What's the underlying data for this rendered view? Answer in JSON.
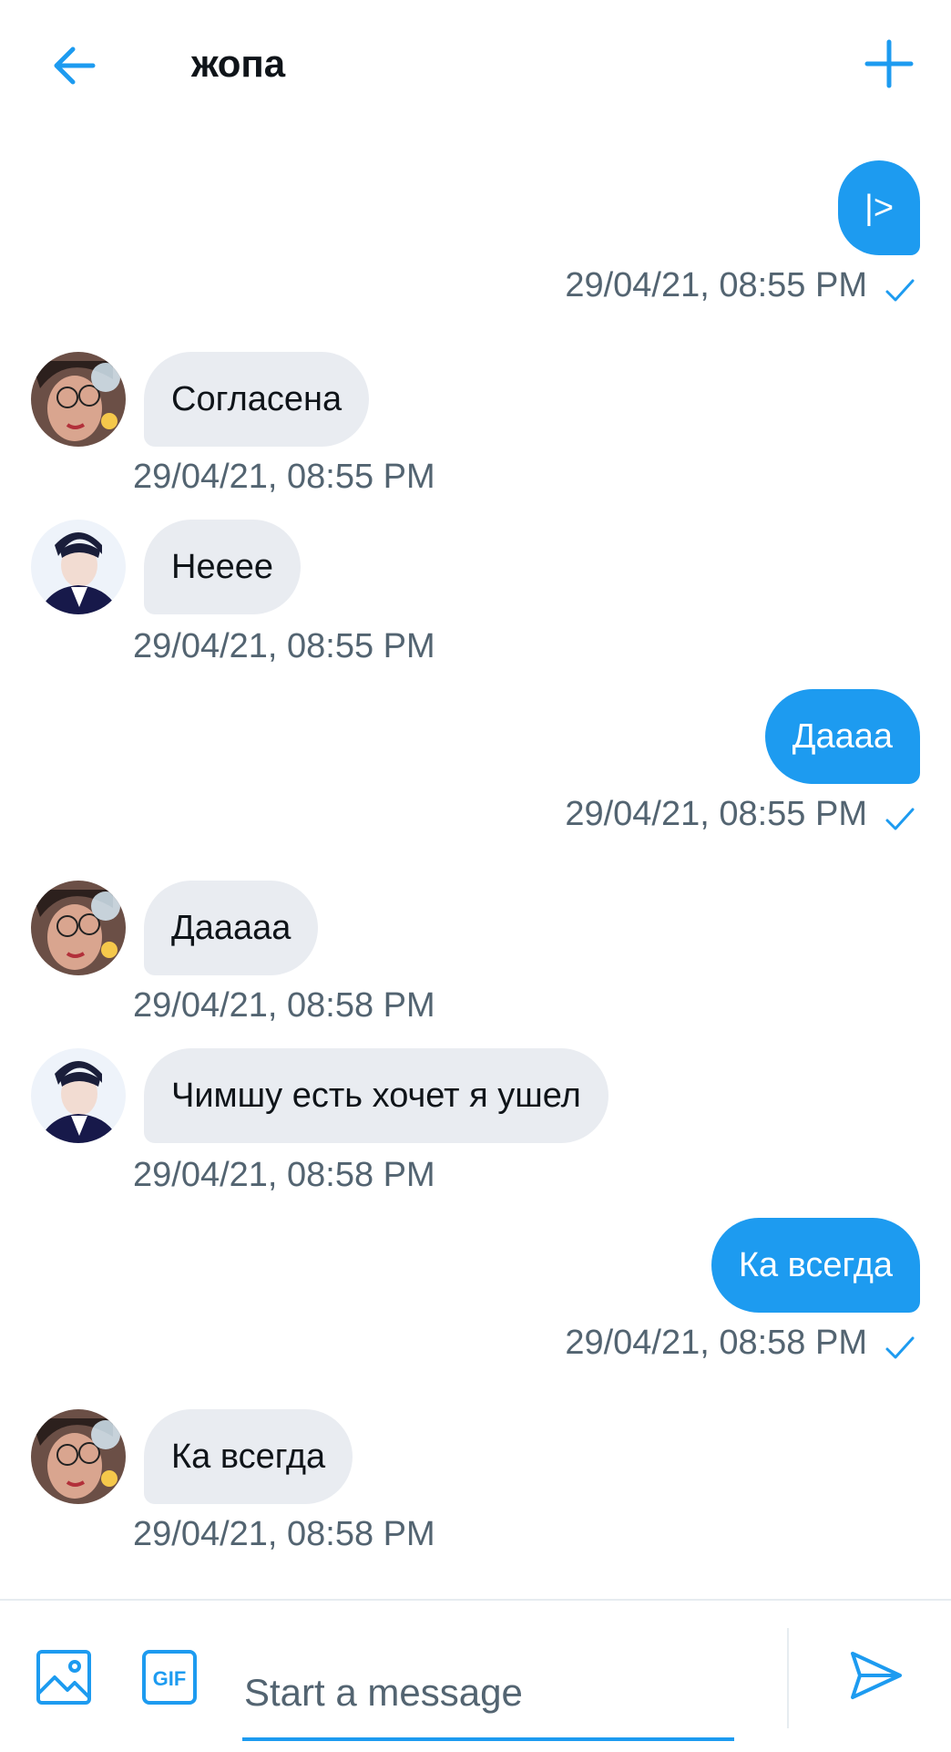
{
  "header": {
    "title": "жопа"
  },
  "colors": {
    "accent": "#1d9bf0",
    "incoming_bubble": "#e9ecf1",
    "timestamp": "#536471"
  },
  "messages": [
    {
      "direction": "outgoing",
      "text": "|>",
      "time": "29/04/21, 08:55 PM",
      "read": true
    },
    {
      "direction": "incoming",
      "sender_avatar": "girl-with-glasses",
      "text": "Согласена",
      "time": "29/04/21, 08:55 PM"
    },
    {
      "direction": "incoming",
      "sender_avatar": "man-in-suit",
      "text": "Нееее",
      "time": "29/04/21, 08:55 PM"
    },
    {
      "direction": "outgoing",
      "text": "Даааа",
      "time": "29/04/21, 08:55 PM",
      "read": true
    },
    {
      "direction": "incoming",
      "sender_avatar": "girl-with-glasses",
      "text": "Даааaa",
      "time": "29/04/21, 08:58 PM"
    },
    {
      "direction": "incoming",
      "sender_avatar": "man-in-suit",
      "text": "Чимшу есть хочет я ушел",
      "time": "29/04/21, 08:58 PM"
    },
    {
      "direction": "outgoing",
      "text": "Ка всегда",
      "time": "29/04/21, 08:58 PM",
      "read": true
    },
    {
      "direction": "incoming",
      "sender_avatar": "girl-with-glasses",
      "text": "Ка всегда",
      "time": "29/04/21, 08:58 PM"
    }
  ],
  "composer": {
    "placeholder": "Start a message",
    "gif_label": "GIF",
    "icons": [
      "image-icon",
      "gif-icon",
      "send-icon"
    ]
  }
}
